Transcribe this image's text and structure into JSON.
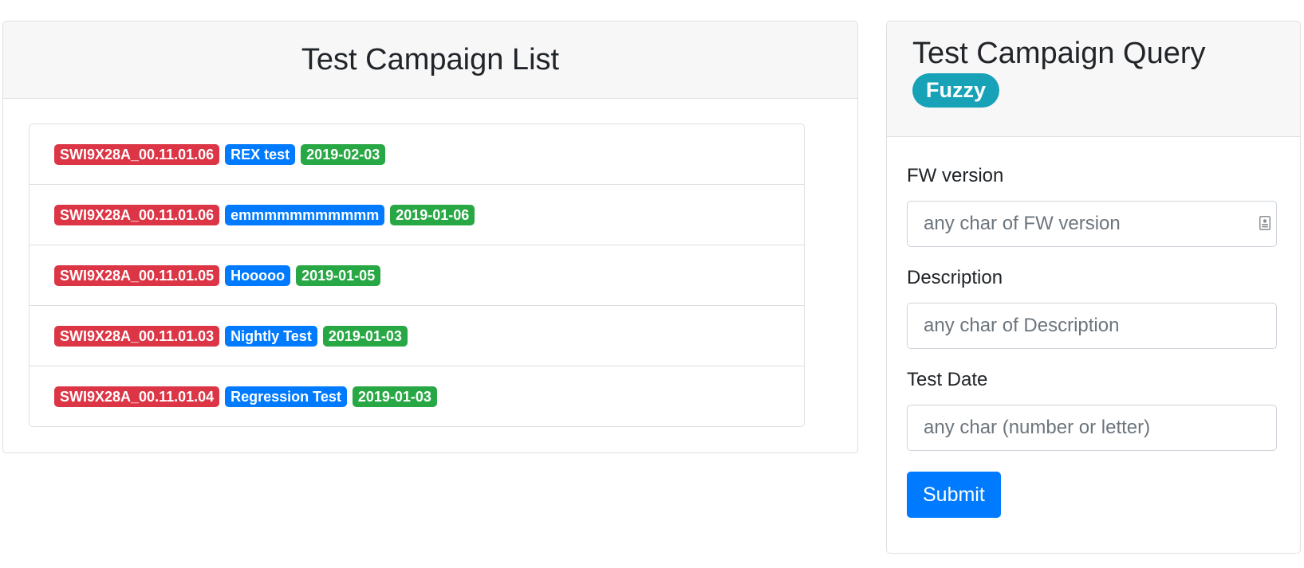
{
  "campaign_list": {
    "title": "Test Campaign List",
    "items": [
      {
        "fw": "SWI9X28A_00.11.01.06",
        "description": "REX test",
        "date": "2019-02-03"
      },
      {
        "fw": "SWI9X28A_00.11.01.06",
        "description": "emmmmmmmmmmm",
        "date": "2019-01-06"
      },
      {
        "fw": "SWI9X28A_00.11.01.05",
        "description": "Hooooo",
        "date": "2019-01-05"
      },
      {
        "fw": "SWI9X28A_00.11.01.03",
        "description": "Nightly Test",
        "date": "2019-01-03"
      },
      {
        "fw": "SWI9X28A_00.11.01.04",
        "description": "Regression Test",
        "date": "2019-01-03"
      }
    ]
  },
  "query": {
    "title": "Test Campaign Query",
    "mode_badge": "Fuzzy",
    "fields": {
      "fw_version": {
        "label": "FW version",
        "placeholder": "any char of FW version",
        "value": ""
      },
      "description": {
        "label": "Description",
        "placeholder": "any char of Description",
        "value": ""
      },
      "test_date": {
        "label": "Test Date",
        "placeholder": "any char (number or letter)",
        "value": ""
      }
    },
    "submit_label": "Submit"
  },
  "colors": {
    "fw_badge": "#dc3545",
    "description_badge": "#007bff",
    "date_badge": "#28a745",
    "mode_badge": "#17a2b8",
    "primary": "#007bff"
  },
  "icons": {
    "fw_input_icon": "contact-card-icon"
  }
}
